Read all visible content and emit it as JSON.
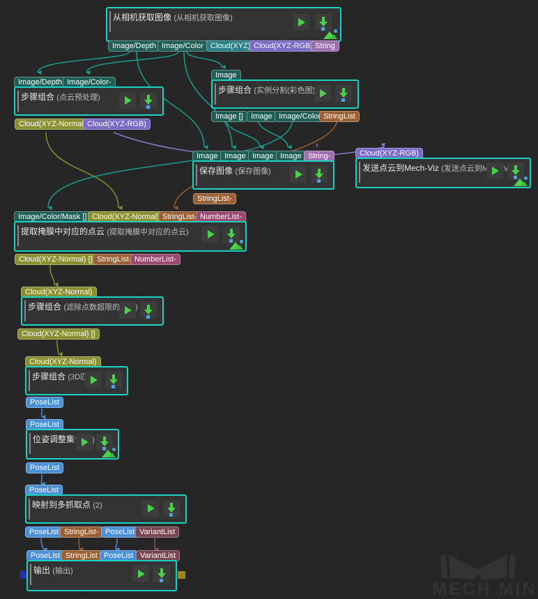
{
  "app": {
    "canvas_bg": "#262626",
    "node_border": "#19d3c5",
    "watermark": "MECH MIND"
  },
  "palette": {
    "image": "#1f5e57",
    "cloud_xyz": "#2a7f86",
    "cloud_xyz_rgb": "#7a69c9",
    "string": "#9d6fae",
    "cloud_xyz_normal": "#8a8f2f",
    "stringlist": "#9a5f33",
    "numberlist": "#9a4a70",
    "poselist": "#4a90d9",
    "variantlist": "#7a4450",
    "mask": "#1f5e57",
    "endpoint_left": "#2b2bb5",
    "endpoint_right": "#9a8a14"
  },
  "nodes": [
    {
      "id": "capture",
      "title": "从相机获取图像",
      "alias": "(从相机获取图像)",
      "has_mountain": true
    },
    {
      "id": "preprocess",
      "title": "步骤组合",
      "alias": "(点云预处理)",
      "has_mountain": false
    },
    {
      "id": "instanceseg",
      "title": "步骤组合",
      "alias": "(实例分割(彩色图))",
      "has_mountain": false
    },
    {
      "id": "saveimage",
      "title": "保存图像",
      "alias": "(保存图像)",
      "has_mountain": false
    },
    {
      "id": "sendviz",
      "title": "发送点云到Mech-Viz",
      "alias": "(发送点云到Mech-Viz)",
      "has_mountain": true
    },
    {
      "id": "extractmask",
      "title": "提取掩膜中对应的点云",
      "alias": "(提取掩膜中对应的点云)",
      "has_mountain": true
    },
    {
      "id": "filtercloud",
      "title": "步骤组合",
      "alias": "(滤除点数超限的点云)",
      "has_mountain": false
    },
    {
      "id": "match3d",
      "title": "步骤组合",
      "alias": "(3D匹配)",
      "has_mountain": false
    },
    {
      "id": "poseadjust",
      "title": "位姿调整集合",
      "alias": "(1)",
      "has_mountain": true
    },
    {
      "id": "mapmulti",
      "title": "映射到多抓取点",
      "alias": "(2)",
      "has_mountain": false
    },
    {
      "id": "output",
      "title": "输出",
      "alias": "(输出)",
      "has_mountain": false
    }
  ],
  "buttons": {
    "play_label": "run-step",
    "download_label": "output-data"
  },
  "ports": {
    "capture_out": [
      "Image/Depth",
      "Image/Color",
      "Cloud(XYZ)",
      "Cloud(XYZ-RGB)",
      "String"
    ],
    "preprocess_in": [
      "Image/Depth",
      "Image/Color-"
    ],
    "preprocess_out": [
      "Cloud(XYZ-Normal)",
      "Cloud(XYZ-RGB)"
    ],
    "instanceseg_in": [
      "Image"
    ],
    "instanceseg_out": [
      "Image []",
      "Image",
      "Image/Color",
      "StringList"
    ],
    "saveimage_in": [
      "Image",
      "Image",
      "Image",
      "Image",
      "String-"
    ],
    "saveimage_out": [
      "StringList-"
    ],
    "sendviz_in": [
      "Cloud(XYZ-RGB)"
    ],
    "extractmask_in": [
      "Image/Color/Mask []",
      "Cloud(XYZ-Normal)",
      "StringList-",
      "NumberList-"
    ],
    "extractmask_out": [
      "Cloud(XYZ-Normal) []",
      "StringList-",
      "NumberList-"
    ],
    "filtercloud_in": [
      "Cloud(XYZ-Normal)"
    ],
    "filtercloud_out": [
      "Cloud(XYZ-Normal) []"
    ],
    "match3d_in": [
      "Cloud(XYZ-Normal)"
    ],
    "match3d_out": [
      "PoseList"
    ],
    "poseadjust_in": [
      "PoseList"
    ],
    "poseadjust_out": [
      "PoseList"
    ],
    "mapmulti_in": [
      "PoseList"
    ],
    "mapmulti_out": [
      "PoseList",
      "StringList-",
      "PoseList",
      "VariantList"
    ],
    "output_in": [
      "PoseList",
      "StringList",
      "PoseList",
      "VariantList"
    ]
  }
}
